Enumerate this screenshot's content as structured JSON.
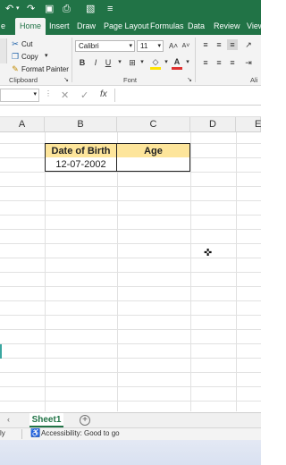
{
  "qat": {
    "icons": [
      "undo-icon",
      "redo-icon",
      "save-icon",
      "touch-mode-icon",
      "printer-icon",
      "customize-icon"
    ]
  },
  "ribbon_tabs": [
    {
      "label": "e",
      "active": false
    },
    {
      "label": "Home",
      "active": true
    },
    {
      "label": "Insert",
      "active": false
    },
    {
      "label": "Draw",
      "active": false
    },
    {
      "label": "Page Layout",
      "active": false
    },
    {
      "label": "Formulas",
      "active": false
    },
    {
      "label": "Data",
      "active": false
    },
    {
      "label": "Review",
      "active": false
    },
    {
      "label": "View",
      "active": false
    }
  ],
  "clipboard": {
    "cut": "Cut",
    "copy": "Copy",
    "format_painter": "Format Painter",
    "group_label": "Clipboard"
  },
  "font": {
    "name": "Calibri",
    "size": "11",
    "bold": "B",
    "italic": "I",
    "underline": "U",
    "group_label": "Font",
    "font_color": "#e03030",
    "fill_color": "#ffe400"
  },
  "alignment": {
    "group_label": "Ali"
  },
  "formula_bar": {
    "fx": "fx",
    "name_box": ""
  },
  "columns": [
    "A",
    "B",
    "C",
    "D",
    "E"
  ],
  "table": {
    "headers": [
      "Date of Birth",
      "Age"
    ],
    "rows": [
      [
        "12-07-2002",
        ""
      ]
    ],
    "header_fill": "#fde59b"
  },
  "sheets": {
    "active": "Sheet1",
    "add": "+"
  },
  "status": {
    "left": "ly",
    "accessibility": "Accessibility: Good to go"
  },
  "colors": {
    "accent": "#217346"
  }
}
